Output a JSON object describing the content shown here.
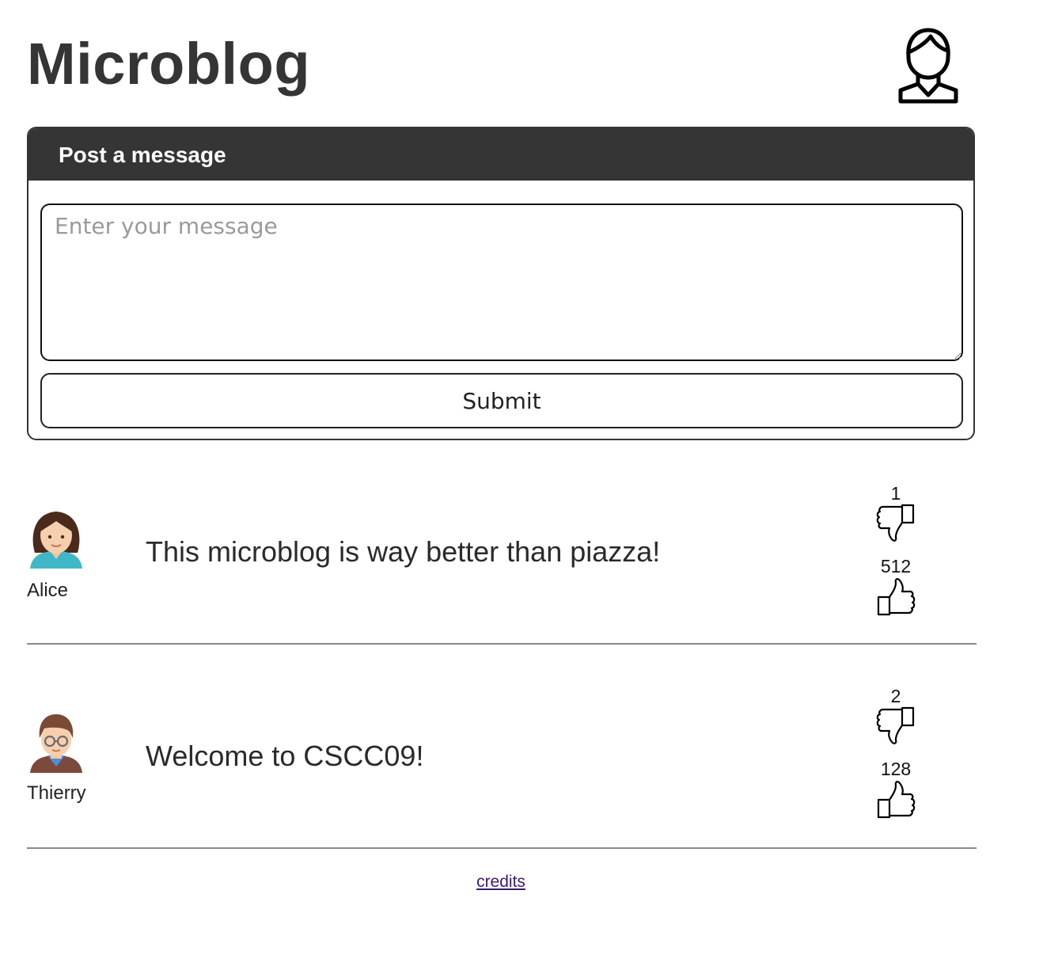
{
  "header": {
    "title": "Microblog",
    "profile_icon": "user-profile-icon"
  },
  "composer": {
    "heading": "Post a message",
    "message_placeholder": "Enter your message",
    "message_value": "",
    "submit_label": "Submit"
  },
  "posts": [
    {
      "author": "Alice",
      "avatar_icon": "woman-avatar-icon",
      "text": "This microblog is way better than piazza!",
      "dislikes": "1",
      "likes": "512"
    },
    {
      "author": "Thierry",
      "avatar_icon": "man-with-glasses-avatar-icon",
      "text": "Welcome to CSCC09!",
      "dislikes": "2",
      "likes": "128"
    }
  ],
  "footer": {
    "credits_label": "credits"
  },
  "colors": {
    "dark": "#353535",
    "link": "#3a1a6e",
    "divider": "#8a8a8a"
  }
}
